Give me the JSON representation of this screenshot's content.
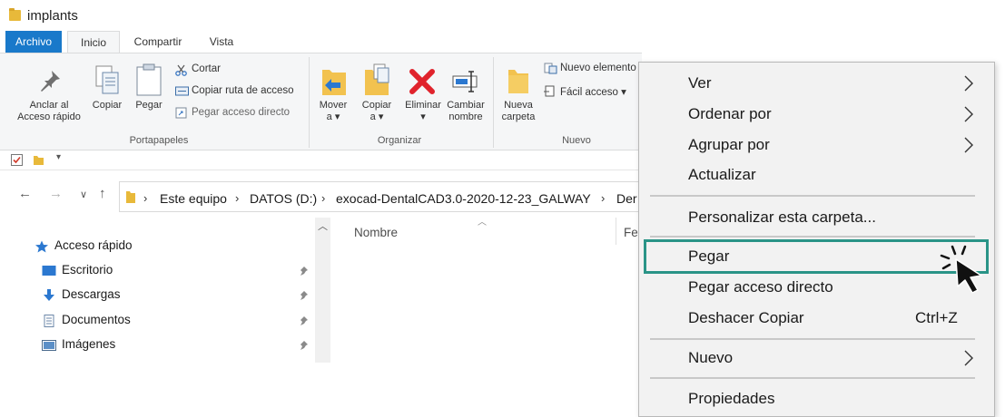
{
  "window": {
    "title": "implants"
  },
  "ribbon": {
    "tabs": [
      "Archivo",
      "Inicio",
      "Compartir",
      "Vista"
    ],
    "clipboard": {
      "pin_label_1": "Anclar al",
      "pin_label_2": "Acceso rápido",
      "copy_label": "Copiar",
      "paste_label": "Pegar",
      "cut_label": "Cortar",
      "copy_path_label": "Copiar ruta de acceso",
      "paste_shortcut_label": "Pegar acceso directo",
      "group_label": "Portapapeles"
    },
    "organize": {
      "move_label": "Mover",
      "move_sub": "a ▾",
      "copyto_label": "Copiar",
      "copyto_sub": "a ▾",
      "delete_label": "Eliminar",
      "delete_sub": "▾",
      "rename_label_1": "Cambiar",
      "rename_label_2": "nombre",
      "group_label": "Organizar"
    },
    "new": {
      "newfolder_label_1": "Nueva",
      "newfolder_label_2": "carpeta",
      "new_item_label": "Nuevo elemento",
      "easy_access_label": "Fácil acceso ▾",
      "group_label": "Nuevo"
    }
  },
  "address": {
    "breadcrumbs": [
      "Este equipo",
      "DATOS (D:)",
      "exocad-DentalCAD3.0-2020-12-23_GALWAY",
      "Der"
    ]
  },
  "navpane": {
    "items": [
      {
        "label": "Acceso rápido"
      },
      {
        "label": "Escritorio"
      },
      {
        "label": "Descargas"
      },
      {
        "label": "Documentos"
      },
      {
        "label": "Imágenes"
      }
    ]
  },
  "content": {
    "columns": [
      "Nombre",
      "Fe"
    ]
  },
  "context_menu": {
    "items": [
      {
        "label": "Ver"
      },
      {
        "label": "Ordenar por"
      },
      {
        "label": "Agrupar por"
      },
      {
        "label": "Actualizar"
      },
      {
        "label": "Personalizar esta carpeta..."
      },
      {
        "label": "Pegar"
      },
      {
        "label": "Pegar acceso directo"
      },
      {
        "label": "Deshacer Copiar",
        "shortcut": "Ctrl+Z"
      },
      {
        "label": "Nuevo"
      },
      {
        "label": "Propiedades"
      }
    ],
    "highlight_color": "#2a9487"
  },
  "colors": {
    "accent": "#1979ca",
    "folder": "#e8b93a",
    "delete_red": "#e0232c",
    "highlight": "#2a9487"
  }
}
